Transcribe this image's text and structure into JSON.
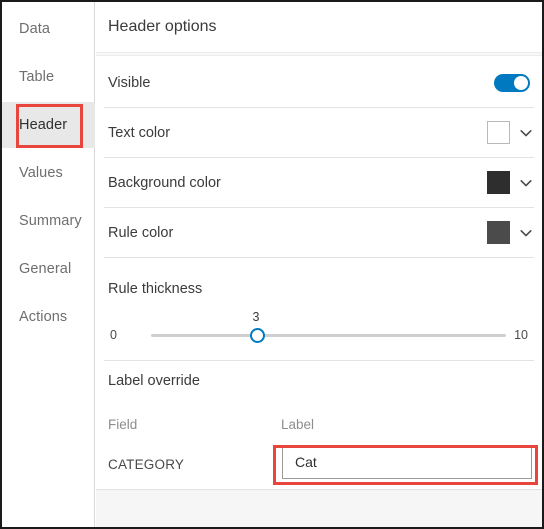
{
  "sidebar": {
    "items": [
      {
        "label": "Data",
        "active": false
      },
      {
        "label": "Table",
        "active": false
      },
      {
        "label": "Header",
        "active": true
      },
      {
        "label": "Values",
        "active": false
      },
      {
        "label": "Summary",
        "active": false
      },
      {
        "label": "General",
        "active": false
      },
      {
        "label": "Actions",
        "active": false
      }
    ]
  },
  "panel": {
    "title": "Header options",
    "rows": {
      "visible": {
        "label": "Visible",
        "toggle_on": true
      },
      "text_color": {
        "label": "Text color",
        "swatch": "#ffffff",
        "chevron": "chevron-down-icon"
      },
      "background_color": {
        "label": "Background color",
        "swatch": "#2e2e2e",
        "chevron": "chevron-down-icon"
      },
      "rule_color": {
        "label": "Rule color",
        "swatch": "#4b4b4b",
        "chevron": "chevron-down-icon"
      }
    },
    "rule_thickness": {
      "label": "Rule thickness",
      "min": "0",
      "max": "10",
      "value": "3"
    },
    "label_override": {
      "title": "Label override",
      "col_field": "Field",
      "col_label": "Label",
      "rows": [
        {
          "field": "CATEGORY",
          "label_value": "Cat",
          "label_placeholder": ""
        }
      ]
    }
  },
  "colors": {
    "accent": "#0079c1",
    "annotation": "#e8453c",
    "active_item_bg": "#e8e8e8"
  }
}
